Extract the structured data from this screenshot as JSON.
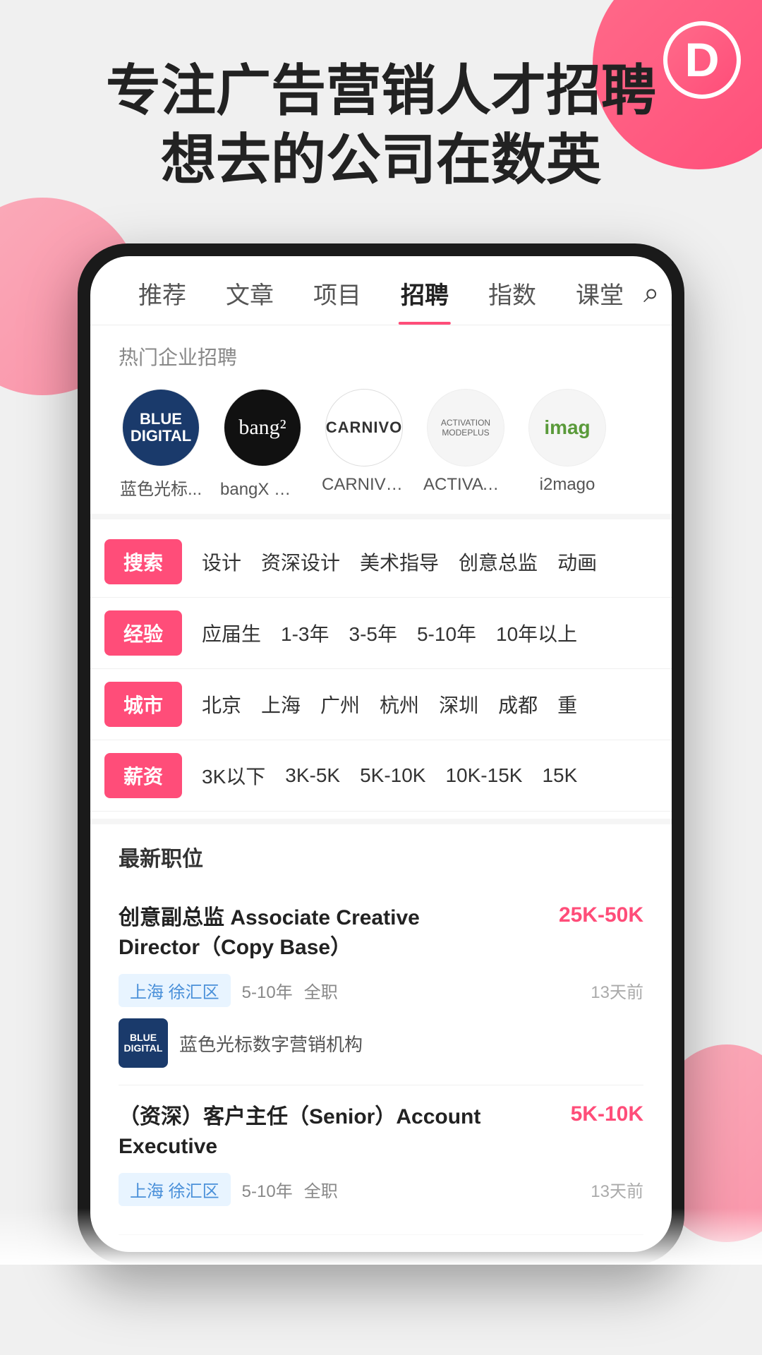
{
  "app": {
    "logo_letter": "D",
    "hero_line1": "专注广告营销人才招聘",
    "hero_line2": "想去的公司在数英"
  },
  "nav": {
    "tabs": [
      {
        "label": "推荐",
        "active": false
      },
      {
        "label": "文章",
        "active": false
      },
      {
        "label": "项目",
        "active": false
      },
      {
        "label": "招聘",
        "active": true
      },
      {
        "label": "指数",
        "active": false
      },
      {
        "label": "课堂",
        "active": false
      }
    ],
    "search_icon": "search"
  },
  "hot_companies": {
    "section_label": "热门企业招聘",
    "items": [
      {
        "id": "blue-digital",
        "name": "蓝色光标...",
        "logo_type": "blue-digital",
        "logo_text": "BLUE\nDIGITAL"
      },
      {
        "id": "bangx",
        "name": "bangX 上海",
        "logo_type": "bangx",
        "logo_text": "bang²"
      },
      {
        "id": "carnivo",
        "name": "CARNIVO...",
        "logo_type": "carnivo",
        "logo_text": "CARNIVO"
      },
      {
        "id": "activation",
        "name": "ACTIVATIO...",
        "logo_type": "activation",
        "logo_text": "ACTIVATION MODEPLUS"
      },
      {
        "id": "imago",
        "name": "i2mago",
        "logo_type": "imago",
        "logo_text": "imag"
      }
    ]
  },
  "filters": [
    {
      "tag": "搜索",
      "options": [
        "设计",
        "资深设计",
        "美术指导",
        "创意总监",
        "动画"
      ]
    },
    {
      "tag": "经验",
      "options": [
        "应届生",
        "1-3年",
        "3-5年",
        "5-10年",
        "10年以上"
      ]
    },
    {
      "tag": "城市",
      "options": [
        "北京",
        "上海",
        "广州",
        "杭州",
        "深圳",
        "成都",
        "重"
      ]
    },
    {
      "tag": "薪资",
      "options": [
        "3K以下",
        "3K-5K",
        "5K-10K",
        "10K-15K",
        "15K"
      ]
    }
  ],
  "jobs": {
    "section_label": "最新职位",
    "items": [
      {
        "title": "创意副总监 Associate Creative Director（Copy Base）",
        "salary": "25K-50K",
        "location": "上海 徐汇区",
        "experience": "5-10年",
        "type": "全职",
        "time": "13天前",
        "company_logo_text": "BLUE\nDIGITAL",
        "company_name": "蓝色光标数字营销机构"
      },
      {
        "title": "（资深）客户主任（Senior）Account Executive",
        "salary": "5K-10K",
        "location": "上海 徐汇区",
        "experience": "5-10年",
        "type": "全职",
        "time": "13天前",
        "company_logo_text": "",
        "company_name": ""
      }
    ]
  }
}
